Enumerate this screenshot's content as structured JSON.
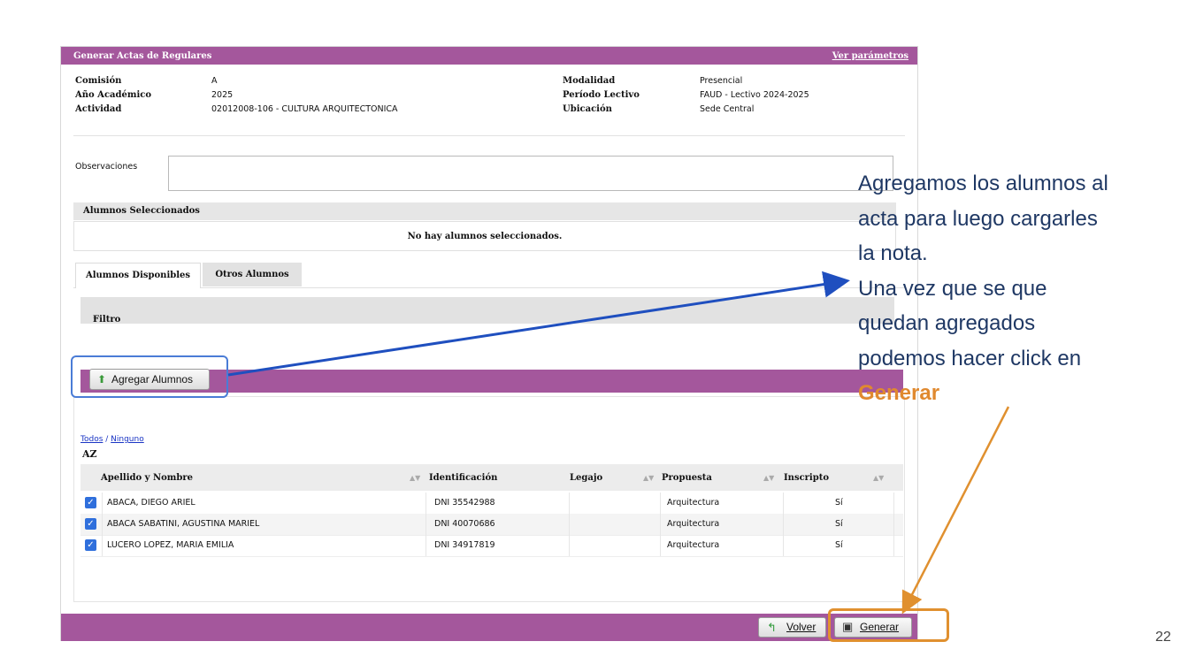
{
  "window": {
    "title": "Generar Actas de Regulares",
    "params_link": "Ver parámetros"
  },
  "info": {
    "comision_label": "Comisión",
    "comision_value": "A",
    "anio_label": "Año Académico",
    "anio_value": "2025",
    "actividad_label": "Actividad",
    "actividad_value": "02012008-106 - CULTURA ARQUITECTONICA",
    "modalidad_label": "Modalidad",
    "modalidad_value": "Presencial",
    "periodo_label": "Período Lectivo",
    "periodo_value": "FAUD - Lectivo 2024-2025",
    "ubicacion_label": "Ubicación",
    "ubicacion_value": "Sede Central"
  },
  "observaciones": {
    "label": "Observaciones",
    "value": ""
  },
  "seleccionados": {
    "header": "Alumnos Seleccionados",
    "empty": "No hay alumnos seleccionados."
  },
  "tabs": [
    {
      "label": "Alumnos Disponibles"
    },
    {
      "label": "Otros Alumnos"
    }
  ],
  "filtro": {
    "label": "Filtro"
  },
  "toolbar": {
    "agregar_label": "Agregar Alumnos"
  },
  "selection": {
    "todos": "Todos",
    "sep": " / ",
    "ninguno": "Ninguno",
    "sort": "AZ"
  },
  "table": {
    "columns": [
      "Apellido y Nombre",
      "Identificación",
      "Legajo",
      "Propuesta",
      "Inscripto"
    ],
    "rows": [
      {
        "nombre": "ABACA, DIEGO ARIEL",
        "id": "DNI 35542988",
        "legajo": "",
        "propuesta": "Arquitectura",
        "inscripto": "Sí",
        "checked": true
      },
      {
        "nombre": "ABACA SABATINI, AGUSTINA MARIEL",
        "id": "DNI 40070686",
        "legajo": "",
        "propuesta": "Arquitectura",
        "inscripto": "Sí",
        "checked": true
      },
      {
        "nombre": "LUCERO LOPEZ, MARIA EMILIA",
        "id": "DNI 34917819",
        "legajo": "",
        "propuesta": "Arquitectura",
        "inscripto": "Sí",
        "checked": true
      }
    ]
  },
  "footer": {
    "volver_label": "Volver",
    "generar_label": "Generar"
  },
  "callout": {
    "lines": [
      "Agregamos los alumnos al",
      "acta para luego cargarles",
      "la nota.",
      "Una vez que se que",
      "quedan agregados",
      "podemos hacer click en"
    ],
    "highlight": "Generar"
  },
  "page_number": "22",
  "colors": {
    "accent": "#a4579c",
    "callout_text": "#1f3864",
    "highlight_orange": "#e0902f",
    "highlight_blue": "#4a7cd6"
  }
}
